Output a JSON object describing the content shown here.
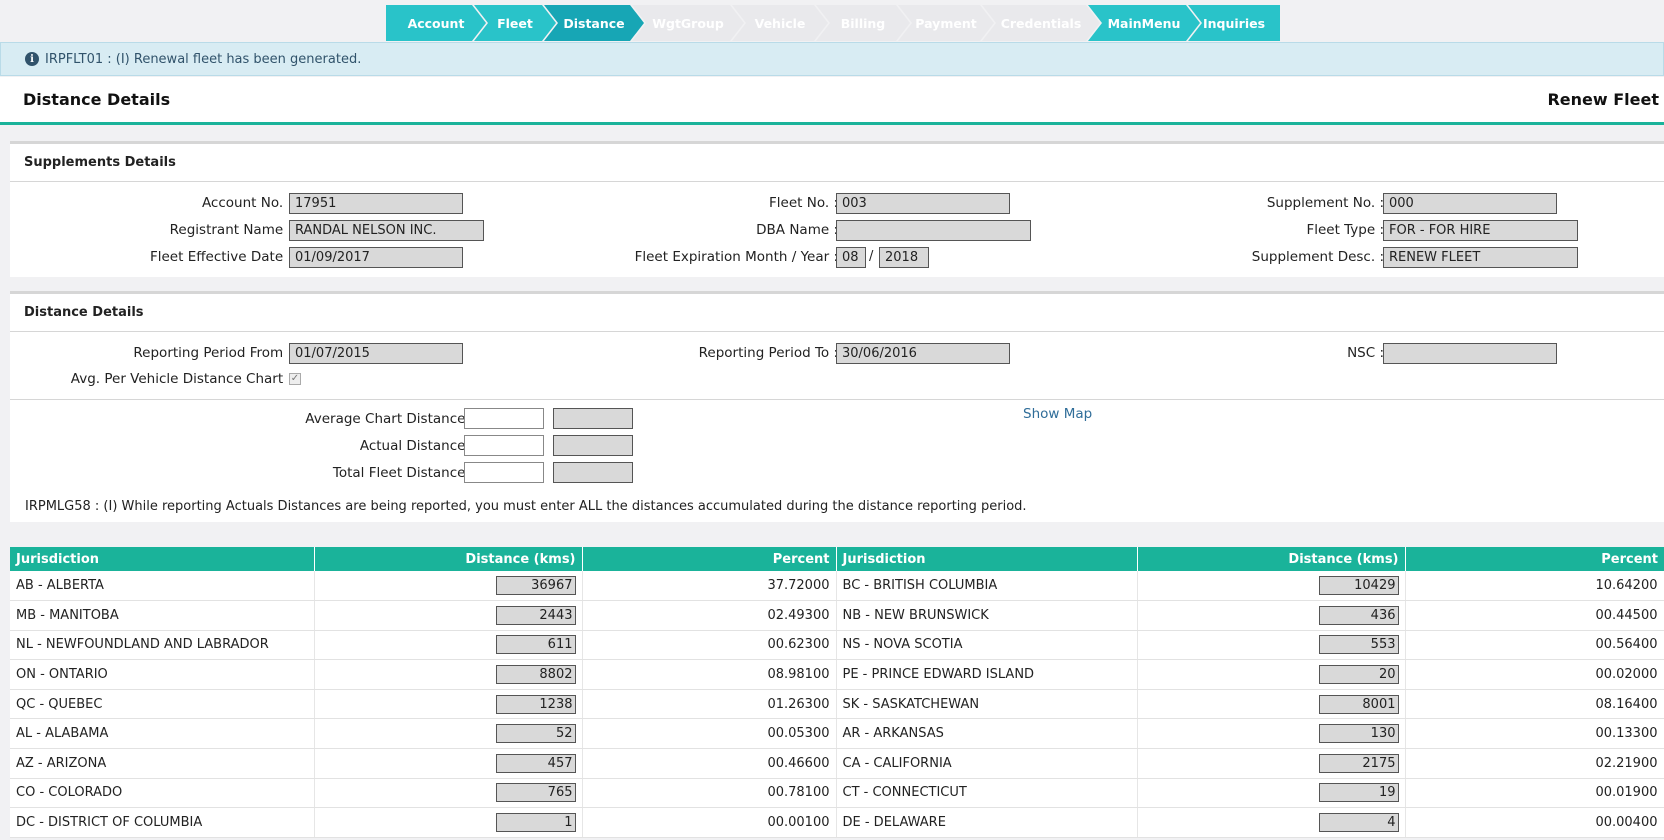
{
  "wizard": {
    "steps": [
      {
        "label": "Account"
      },
      {
        "label": "Fleet"
      },
      {
        "label": "Distance"
      },
      {
        "label": "WgtGroup"
      },
      {
        "label": "Vehicle"
      },
      {
        "label": "Billing"
      },
      {
        "label": "Payment"
      },
      {
        "label": "Credentials"
      },
      {
        "label": "MainMenu"
      },
      {
        "label": "Inquiries"
      }
    ]
  },
  "info": {
    "message": "IRPFLT01 : (I) Renewal fleet has been generated."
  },
  "header": {
    "title": "Distance Details",
    "mode": "Renew Fleet"
  },
  "supplements": {
    "title": "Supplements Details",
    "account_no_label": "Account No. :",
    "account_no": "17951",
    "fleet_no_label": "Fleet No. :",
    "fleet_no": "003",
    "supplement_no_label": "Supplement No. :",
    "supplement_no": "000",
    "registrant_label": "Registrant Name :",
    "registrant": "RANDAL NELSON INC.",
    "dba_label": "DBA Name :",
    "dba": "",
    "fleet_type_label": "Fleet Type :",
    "fleet_type": "FOR - FOR HIRE",
    "effective_label": "Fleet Effective Date :",
    "effective": "01/09/2017",
    "expiration_label": "Fleet Expiration Month / Year :",
    "exp_month": "08",
    "exp_sep": "/",
    "exp_year": "2018",
    "desc_label": "Supplement Desc. :",
    "desc": "RENEW FLEET"
  },
  "distance": {
    "title": "Distance Details",
    "from_label": "Reporting Period From :",
    "from": "01/07/2015",
    "to_label": "Reporting Period To :",
    "to": "30/06/2016",
    "nsc_label": "NSC :",
    "nsc": "",
    "avg_chart_label": "Avg. Per Vehicle Distance Chart :",
    "avg_chart_checked": true,
    "check_glyph": "✓",
    "average_label": "Average Chart Distance:",
    "actual_label": "Actual Distance:",
    "total_label": "Total Fleet Distance:",
    "show_map": "Show Map",
    "note": "IRPMLG58 : (I) While reporting Actuals Distances are being reported, you must enter ALL the distances accumulated during the distance reporting period."
  },
  "table": {
    "headers": [
      "Jurisdiction",
      "Distance (kms)",
      "Percent",
      "Jurisdiction",
      "Distance (kms)",
      "Percent"
    ],
    "rows": [
      [
        "AB - ALBERTA",
        "36967",
        "37.72000",
        "BC - BRITISH COLUMBIA",
        "10429",
        "10.64200"
      ],
      [
        "MB - MANITOBA",
        "2443",
        "02.49300",
        "NB - NEW BRUNSWICK",
        "436",
        "00.44500"
      ],
      [
        "NL - NEWFOUNDLAND AND LABRADOR",
        "611",
        "00.62300",
        "NS - NOVA SCOTIA",
        "553",
        "00.56400"
      ],
      [
        "ON - ONTARIO",
        "8802",
        "08.98100",
        "PE - PRINCE EDWARD ISLAND",
        "20",
        "00.02000"
      ],
      [
        "QC - QUEBEC",
        "1238",
        "01.26300",
        "SK - SASKATCHEWAN",
        "8001",
        "08.16400"
      ],
      [
        "AL - ALABAMA",
        "52",
        "00.05300",
        "AR - ARKANSAS",
        "130",
        "00.13300"
      ],
      [
        "AZ - ARIZONA",
        "457",
        "00.46600",
        "CA - CALIFORNIA",
        "2175",
        "02.21900"
      ],
      [
        "CO - COLORADO",
        "765",
        "00.78100",
        "CT - CONNECTICUT",
        "19",
        "00.01900"
      ],
      [
        "DC - DISTRICT OF COLUMBIA",
        "1",
        "00.00100",
        "DE - DELAWARE",
        "4",
        "00.00400"
      ]
    ]
  },
  "colors": {
    "accent": "#1ab39a",
    "wizard": "#29c3c9",
    "wizard_active": "#17a6b5"
  }
}
